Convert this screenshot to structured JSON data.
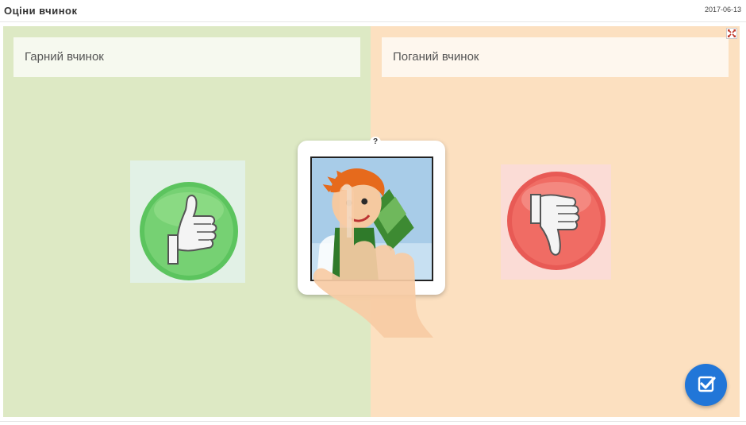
{
  "header": {
    "title": "Оціни вчинок",
    "date": "2017-06-13"
  },
  "categories": [
    {
      "label": "Гарний вчинок",
      "icon": "thumbs-up-icon",
      "color": "#5cc45e"
    },
    {
      "label": "Поганий вчинок",
      "icon": "thumbs-down-icon",
      "color": "#e85a55"
    }
  ],
  "card": {
    "hint": "?",
    "image": "boy-with-book-image"
  },
  "controls": {
    "expand_icon": "expand-icon",
    "check_icon": "check-icon"
  },
  "colors": {
    "good_bg": "#dde9c4",
    "bad_bg": "#fce0c0",
    "check_button": "#2176d8"
  }
}
